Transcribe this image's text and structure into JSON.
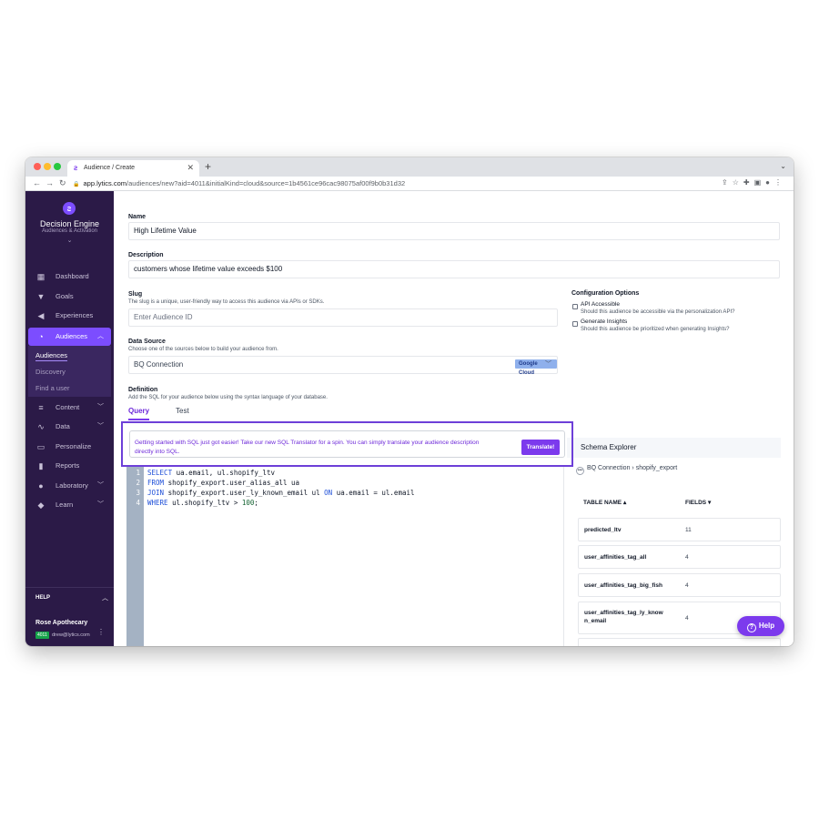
{
  "browser": {
    "tab_title": "Audience / Create",
    "url_host": "app.lytics.com",
    "url_path": "/audiences/new?aid=4011&initialKind=cloud&source=1b4561ce96cac98075af00f9b0b31d32"
  },
  "sidebar": {
    "brand": "Decision Engine",
    "brand_sub": "Audiences & Activation",
    "items": [
      {
        "label": "Dashboard",
        "icon": "dashboard-icon"
      },
      {
        "label": "Goals",
        "icon": "funnel-icon"
      },
      {
        "label": "Experiences",
        "icon": "megaphone-icon"
      },
      {
        "label": "Audiences",
        "icon": "pie-chart-icon"
      },
      {
        "label": "Content",
        "icon": "list-icon"
      },
      {
        "label": "Data",
        "icon": "pulse-icon"
      },
      {
        "label": "Personalize",
        "icon": "window-icon"
      },
      {
        "label": "Reports",
        "icon": "bar-chart-icon"
      },
      {
        "label": "Laboratory",
        "icon": "lightbulb-icon"
      },
      {
        "label": "Learn",
        "icon": "graduation-cap-icon"
      }
    ],
    "sub_items": [
      "Audiences",
      "Discovery",
      "Find a user"
    ],
    "help_label": "HELP",
    "account_name": "Rose Apothecary",
    "account_badge": "4011",
    "account_email": "drew@lytics.com"
  },
  "form": {
    "name_label": "Name",
    "name_value": "High Lifetime Value",
    "description_label": "Description",
    "description_value": "customers whose lifetime value exceeds $100",
    "slug_label": "Slug",
    "slug_help": "The slug is a unique, user-friendly way to access this audience via APIs or SDKs.",
    "slug_placeholder": "Enter Audience ID",
    "datasource_label": "Data Source",
    "datasource_help": "Choose one of the sources below to build your audience from.",
    "datasource_value": "BQ Connection",
    "datasource_badge": "Google Cloud",
    "definition_label": "Definition",
    "definition_help": "Add the SQL for your audience below using the syntax language of your database.",
    "tabs": [
      "Query",
      "Test"
    ]
  },
  "config": {
    "title": "Configuration Options",
    "options": [
      {
        "label": "API Accessible",
        "help": "Should this audience be accessible via the personalization API?"
      },
      {
        "label": "Generate Insights",
        "help": "Should this audience be prioritized when generating Insights?"
      }
    ]
  },
  "banner": {
    "text": "Getting started with SQL just got easier! Take our new SQL Translator for a spin. You can simply translate your audience description directly into SQL.",
    "button": "Translate!"
  },
  "editor": {
    "lines": [
      {
        "n": "1",
        "kw": "SELECT",
        "rest": " ua.email, ul.shopify_ltv"
      },
      {
        "n": "2",
        "kw": "FROM",
        "rest": " shopify_export.user_alias_all ua"
      },
      {
        "n": "3",
        "kw": "JOIN",
        "rest": " shopify_export.user_ly_known_email ul ",
        "kw2": "ON",
        "rest2": " ua.email = ul.email"
      },
      {
        "n": "4",
        "kw": "WHERE",
        "rest": " ul.shopify_ltv > ",
        "num": "100",
        "tail": ";"
      }
    ]
  },
  "schema": {
    "title": "Schema Explorer",
    "connection": "BQ Connection",
    "dataset": "shopify_export",
    "col_table": "TABLE NAME",
    "col_fields": "FIELDS",
    "rows": [
      {
        "name": "predicted_ltv",
        "fields": "11"
      },
      {
        "name": "user_affinities_tag_all",
        "fields": "4"
      },
      {
        "name": "user_affinities_tag_big_fish",
        "fields": "4"
      },
      {
        "name": "user_affinities_tag_ly_known_email",
        "name_line1": "user_affinities_tag_ly_know",
        "name_line2": "n_email",
        "fields": "4"
      }
    ]
  },
  "help_button": "Help",
  "colors": {
    "sidebar_bg": "#2b1a47",
    "accent": "#7c3aed",
    "google_cloud_badge": "#8fb0ec"
  }
}
